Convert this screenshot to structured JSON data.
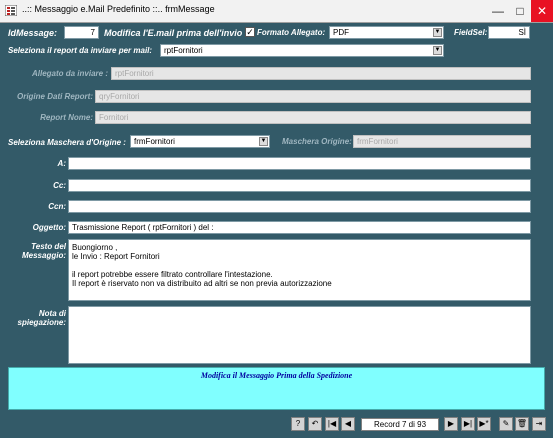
{
  "window": {
    "title": "..:: Messaggio e.Mail Predefinito ::..   frmMessage",
    "min": "—",
    "max": "□",
    "close": "✕"
  },
  "labels": {
    "id": "IdMessage:",
    "modifica": "Modifica l'E.mail prima dell'invio",
    "formato": "Formato Allegato:",
    "fieldsel": "FieldSel:",
    "seleziona_report": "Seleziona il report da inviare per mail:",
    "allegato": "Allegato da inviare :",
    "origine_dati": "Origine Dati Report:",
    "report_nome": "Report Nome:",
    "seleziona_maschera": "Seleziona Maschera d'Origine :",
    "maschera_origine": "Maschera Origine:",
    "a": "A:",
    "cc": "Cc:",
    "ccn": "Ccn:",
    "oggetto": "Oggetto:",
    "testo": "Testo del Messaggio:",
    "nota": "Nota di spiegazione:"
  },
  "values": {
    "id": "7",
    "modifica_checked": "✓",
    "formato": "PDF",
    "fieldsel": "SÌ",
    "report": "rptFornitori",
    "allegato": "rptFornitori",
    "origine_dati": "qryFornitori",
    "report_nome": "Fornitori",
    "maschera": "frmFornitori",
    "maschera_origine": "frmFornitori",
    "a": "",
    "cc": "",
    "ccn": "",
    "oggetto": "Trasmissione Report  ( rptFornitori ) del  :",
    "testo": "Buongiorno ,\nle Invio : Report Fornitori\n\nil report potrebbe essere filtrato controllare l'intestazione.\nIl report è riservato non va distribuito ad altri se non previa autorizzazione",
    "nota": ""
  },
  "banner": "Modifica il Messaggio Prima della Spedizione",
  "nav": {
    "record": "Record 7 di 93",
    "help_icon": "?",
    "undo_icon": "↶",
    "first_icon": "|◀",
    "prev_icon": "◀",
    "next_icon": "▶",
    "last_icon": "▶|",
    "new_icon": "▶*",
    "new_record_icon": "✎",
    "delete_icon": "🗑",
    "exit_icon": "⇥"
  },
  "colors": {
    "background": "#335a68",
    "banner": "#80ffff",
    "banner_text": "#0000a0",
    "label": "#ffffff"
  }
}
